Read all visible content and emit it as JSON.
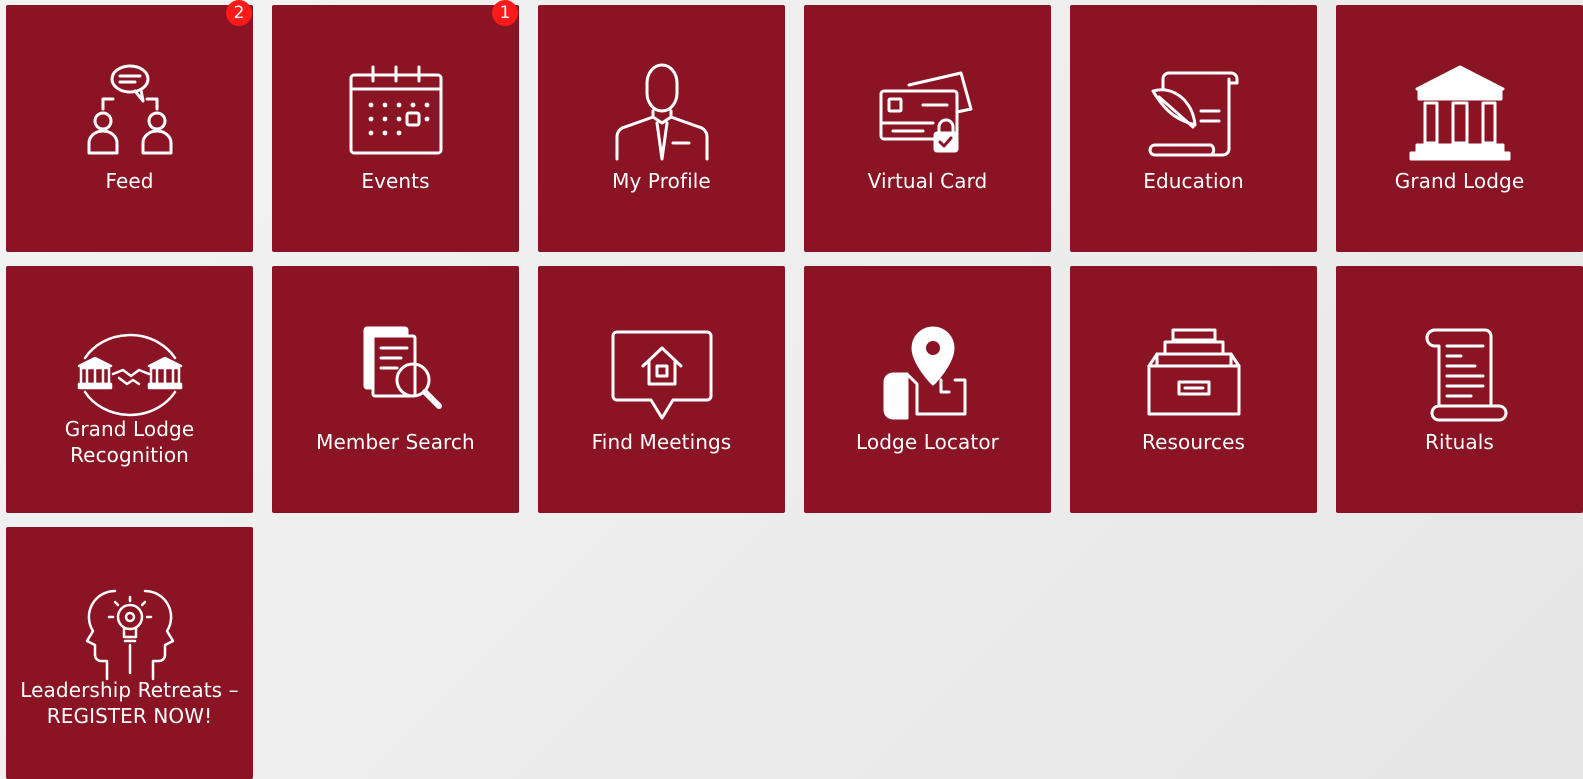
{
  "tiles": [
    {
      "label": "Feed",
      "badge": "2",
      "icon": "feed-chat-icon"
    },
    {
      "label": "Events",
      "badge": "1",
      "icon": "calendar-icon"
    },
    {
      "label": "My Profile",
      "icon": "profile-person-icon"
    },
    {
      "label": "Virtual Card",
      "icon": "virtual-card-icon"
    },
    {
      "label": "Education",
      "icon": "scroll-quill-icon"
    },
    {
      "label": "Grand Lodge",
      "icon": "temple-icon"
    },
    {
      "label_line1": "Grand Lodge",
      "label_line2": "Recognition",
      "icon": "temples-handshake-icon"
    },
    {
      "label": "Member Search",
      "icon": "document-search-icon"
    },
    {
      "label": "Find Meetings",
      "icon": "house-pin-bubble-icon"
    },
    {
      "label": "Lodge Locator",
      "icon": "map-pin-icon"
    },
    {
      "label": "Resources",
      "icon": "file-drawer-icon"
    },
    {
      "label": "Rituals",
      "icon": "scroll-icon"
    },
    {
      "label_line1": "Leadership Retreats –",
      "label_line2": "REGISTER NOW!",
      "icon": "mind-lightbulb-icon"
    }
  ],
  "colors": {
    "tile_bg": "#8a1424",
    "badge_bg": "#ff1a1a",
    "page_bg": "#efefef",
    "text": "#ffffff"
  }
}
